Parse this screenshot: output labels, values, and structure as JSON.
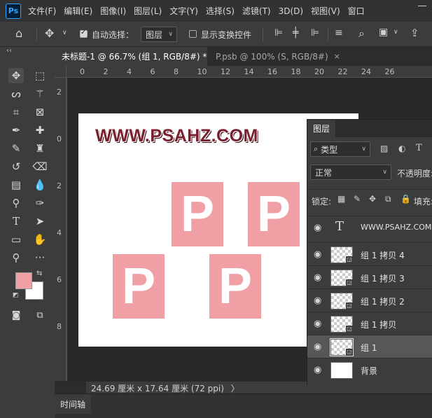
{
  "menu": {
    "app_logo": "Ps",
    "items": [
      "文件(F)",
      "编辑(E)",
      "图像(I)",
      "图层(L)",
      "文字(Y)",
      "选择(S)",
      "滤镜(T)",
      "3D(D)",
      "视图(V)",
      "窗口"
    ]
  },
  "options": {
    "auto_select_label": "自动选择：",
    "auto_select_target": "图层",
    "show_transform_label": "显示变换控件"
  },
  "tabs": [
    {
      "label": "未标题-1 @ 66.7% (组 1, RGB/8#) *",
      "close": "×"
    },
    {
      "label": "P.psb @ 100% (S, RGB/8#)",
      "close": "×"
    }
  ],
  "ruler": {
    "h_numbers": [
      "0",
      "2",
      "4",
      "6",
      "8",
      "10",
      "12",
      "14",
      "16",
      "18",
      "20",
      "22",
      "24",
      "26"
    ],
    "v_numbers": [
      "2",
      "0",
      "2",
      "4",
      "6",
      "8"
    ]
  },
  "canvas": {
    "watermark": "WWW.PSAHZ.COM",
    "letter": "P",
    "tile_color": "#f0a0a4"
  },
  "status": {
    "doc_size": "24.69 厘米 x 17.64 厘米 (72 ppi)",
    "arrow": "〉"
  },
  "timeline": {
    "label": "时间轴"
  },
  "toolbar": {
    "foreground_color": "#f0a0a4",
    "background_color": "#ffffff",
    "collapse": "‹‹"
  },
  "layers": {
    "tab": "图层",
    "filter_kind": "类型",
    "blend_mode": "正常",
    "opacity_label": "不透明度:",
    "lock_label": "锁定:",
    "fill_label": "填充:",
    "items": [
      {
        "name": "WWW.PSAHZ.COM",
        "type": "text"
      },
      {
        "name": "组 1 拷贝 4",
        "type": "smart"
      },
      {
        "name": "组 1 拷贝 3",
        "type": "smart"
      },
      {
        "name": "组 1 拷贝 2",
        "type": "smart"
      },
      {
        "name": "组 1 拷贝",
        "type": "smart"
      },
      {
        "name": "组 1",
        "type": "smart",
        "selected": true
      },
      {
        "name": "背景",
        "type": "background"
      }
    ]
  }
}
